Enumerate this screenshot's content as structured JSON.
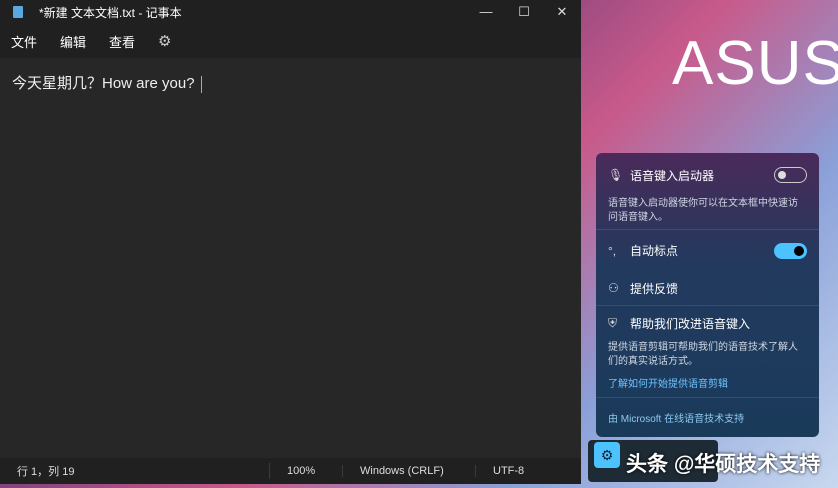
{
  "window": {
    "title": "*新建 文本文档.txt - 记事本",
    "minimize": "—",
    "maximize": "☐",
    "close": "✕"
  },
  "menu": [
    "文件",
    "编辑",
    "查看"
  ],
  "editor": {
    "text": "今天星期几？How are you?"
  },
  "status": {
    "position": "行 1，列 19",
    "zoom": "100%",
    "line_ending": "Windows (CRLF)",
    "encoding": "UTF-8"
  },
  "wallpaper": {
    "brand": "ASUS"
  },
  "voice_panel": {
    "launcher_label": "语音键入启动器",
    "launcher_on": false,
    "launcher_desc": "语音键入启动器使你可以在文本框中快速访问语音键入。",
    "auto_punct_label": "自动标点",
    "auto_punct_on": true,
    "feedback_label": "提供反馈",
    "improve_label": "帮助我们改进语音键入",
    "improve_desc": "提供语音剪辑可帮助我们的语音技术了解人们的真实说话方式。",
    "learn_link": "了解如何开始提供语音剪辑",
    "footer": "由 Microsoft 在线语音技术支持"
  },
  "watermark": "头条 @华硕技术支持",
  "colors": {
    "accent": "#4cc2ff"
  }
}
